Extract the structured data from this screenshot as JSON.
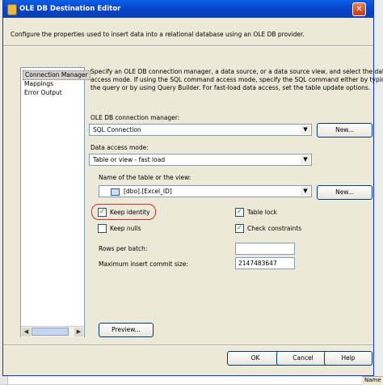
{
  "window": {
    "title": "OLE DB Destination Editor",
    "close_glyph": "✕"
  },
  "description": "Configure the properties used to insert data into a relational database using an OLE DB provider.",
  "nav": {
    "items": [
      {
        "label": "Connection Manager"
      },
      {
        "label": "Mappings"
      },
      {
        "label": "Error Output"
      }
    ],
    "scroll_left": "◀",
    "scroll_right": "▶"
  },
  "main": {
    "instructions": [
      "Specify an OLE DB connection manager, a data source, or a data source view, and select the data",
      "access mode. If using the SQL command access mode, specify the SQL command either by typing",
      "the query or by using Query Builder. For fast-load data access, set the table update options."
    ],
    "connection_label": "OLE DB connection manager:",
    "connection_value": "SQL Connection",
    "new_button_1": "New...",
    "access_mode_label": "Data access mode:",
    "access_mode_value": "Table or view - fast load",
    "table_label": "Name of the table or the view:",
    "table_value": "[dbo].[Excel_ID]",
    "new_button_2": "New...",
    "options": {
      "keep_identity": {
        "label": "Keep identity",
        "checked": true
      },
      "table_lock": {
        "label": "Table lock",
        "checked": true
      },
      "keep_nulls": {
        "label": "Keep nulls",
        "checked": false
      },
      "check_constraints": {
        "label": "Check constraints",
        "checked": true
      }
    },
    "rows_per_batch_label": "Rows per batch:",
    "rows_per_batch_value": "",
    "max_commit_label": "Maximum insert commit size:",
    "max_commit_value": "2147483647",
    "preview_button": "Preview..."
  },
  "footer": {
    "ok": "OK",
    "cancel": "Cancel",
    "help": "Help"
  },
  "background": {
    "right_label": "Name"
  },
  "glyphs": {
    "dropdown": "▼",
    "check": "✓"
  }
}
